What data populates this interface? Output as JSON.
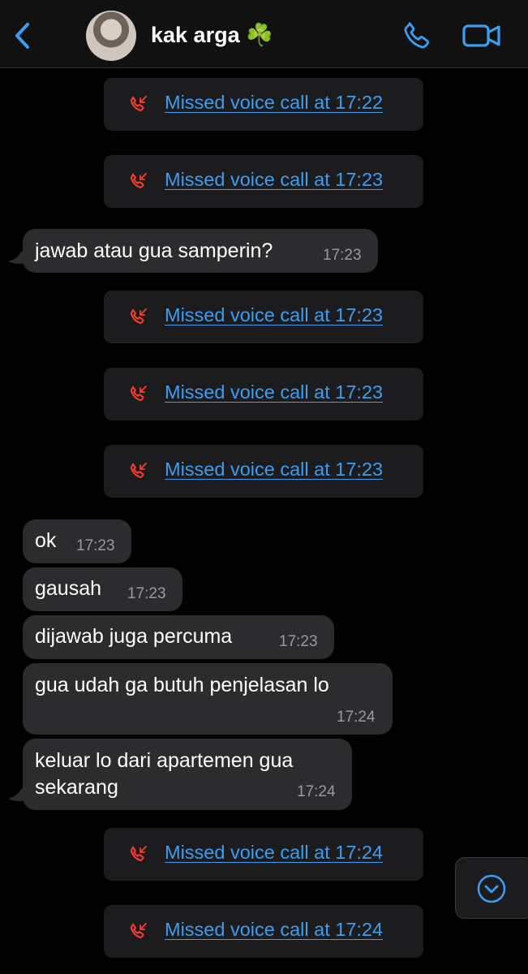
{
  "contact": {
    "name": "kak arga ☘️"
  },
  "missed_calls": [
    {
      "label": "Missed voice call at 17:22"
    },
    {
      "label": "Missed voice call at 17:23"
    },
    {
      "label": "Missed voice call at 17:23"
    },
    {
      "label": "Missed voice call at 17:23"
    },
    {
      "label": "Missed voice call at 17:23"
    },
    {
      "label": "Missed voice call at 17:24"
    },
    {
      "label": "Missed voice call at 17:24"
    }
  ],
  "messages": [
    {
      "text": "jawab atau gua samperin?",
      "time": "17:23"
    },
    {
      "text": "ok",
      "time": "17:23"
    },
    {
      "text": "gausah",
      "time": "17:23"
    },
    {
      "text": "dijawab juga percuma",
      "time": "17:23"
    },
    {
      "text": "gua udah ga butuh penjelasan lo",
      "time": "17:24"
    },
    {
      "text_line1": "keluar lo dari apartemen gua",
      "text_line2": "sekarang",
      "time": "17:24"
    }
  ],
  "colors": {
    "accent": "#3d9df0",
    "missed": "#ff3b30",
    "bubble": "#2c2c2e",
    "call_bubble": "#1c1c1e"
  }
}
